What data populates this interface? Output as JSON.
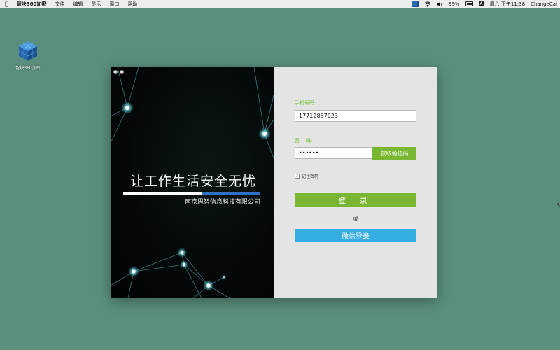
{
  "menubar": {
    "apple_icon": "apple-logo-icon",
    "app_name": "智块360加密",
    "menus": [
      "文件",
      "编辑",
      "显示",
      "窗口",
      "帮助"
    ],
    "tray": {
      "app_icon": "cube-icon",
      "wifi_icon": "wifi-icon",
      "battery_percent": "99%",
      "volume_icon": "speaker-icon",
      "battery_icon": "battery-icon",
      "keyboard_badge": "A",
      "datetime": "周六 下午11:38",
      "input_method": "ChangeCal"
    }
  },
  "desktop": {
    "icon_label": "智块360加密"
  },
  "login": {
    "slogan": "让工作生活安全无忧",
    "company": "南京思智信息科技有限公司",
    "phone_label": "手机号码:",
    "phone_value": "17712857023",
    "password_label": "密    码:",
    "password_value": "••••••",
    "get_code_button": "获取验证码",
    "remember_label": "记住密码",
    "remember_checked": true,
    "login_button": "登 录",
    "or_text": "或",
    "wechat_button": "微信登录"
  },
  "colors": {
    "desktop": "#5a8f7d",
    "green": "#79b733",
    "blue": "#36ade2",
    "panel": "#e4e4e4"
  }
}
